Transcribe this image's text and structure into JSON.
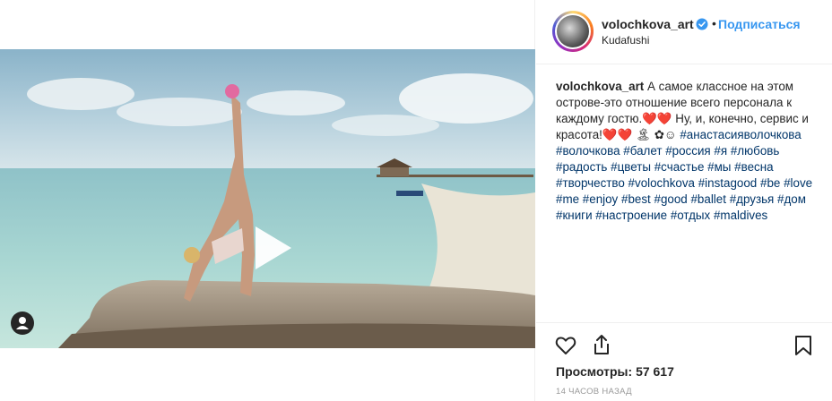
{
  "post": {
    "username": "volochkova_art",
    "follow_label": "Подписаться",
    "separator": "•",
    "location": "Kudafushi",
    "caption_user": "volochkova_art",
    "caption_text": "А самое классное на этом острове-это отношение всего персонала к каждому гостю.❤️❤️ Ну, и, конечно, сервис и красота!❤️❤️ 🏝 ✿☺",
    "hashtags": [
      "#анастасияволочкова",
      "#волочкова",
      "#балет",
      "#россия",
      "#я",
      "#любовь",
      "#радость",
      "#цветы",
      "#счастье",
      "#мы",
      "#весна",
      "#творчество",
      "#volochkova",
      "#instagood",
      "#be",
      "#love",
      "#me",
      "#enjoy",
      "#best",
      "#good",
      "#ballet",
      "#друзья",
      "#дом",
      "#книги",
      "#настроение",
      "#отдых",
      "#maldives"
    ],
    "views_label": "Просмотры:",
    "views_count": "57 617",
    "timestamp": "14 часов назад"
  },
  "icons": {
    "verified": "verified-badge-icon",
    "like": "heart-outline-icon",
    "share": "share-icon",
    "save": "bookmark-icon",
    "play": "play-icon",
    "user_tag": "user-tag-icon"
  },
  "colors": {
    "link_blue": "#3897f0",
    "hashtag": "#003569",
    "text": "#262626",
    "muted": "#999999"
  }
}
